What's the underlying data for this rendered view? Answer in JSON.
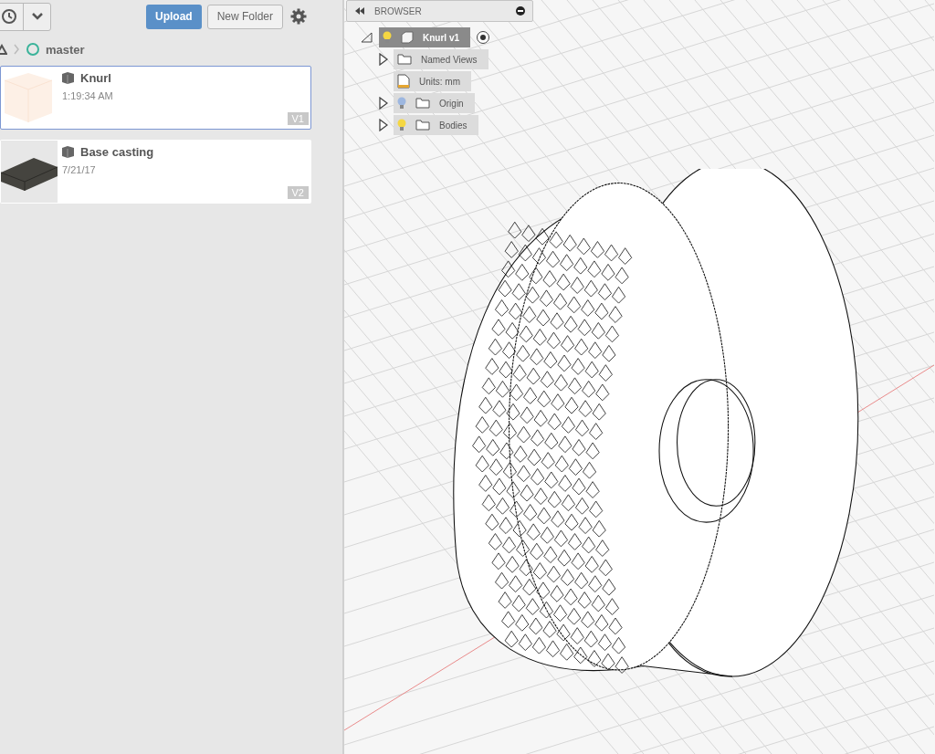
{
  "toolbar": {
    "upload": "Upload",
    "new_folder": "New Folder"
  },
  "breadcrumb": {
    "branch": "master"
  },
  "files": [
    {
      "name": "Knurl",
      "date": "1:19:34 AM",
      "version": "V1",
      "selected": true,
      "kind": "cube"
    },
    {
      "name": "Base casting",
      "date": "7/21/17",
      "version": "V2",
      "selected": false,
      "kind": "slab"
    }
  ],
  "browser": {
    "title": "BROWSER",
    "root": {
      "label": "Knurl v1",
      "selected": true,
      "visible": true,
      "children": [
        {
          "kind": "folder",
          "label": "Named Views"
        },
        {
          "kind": "units",
          "label": "Units: mm"
        },
        {
          "kind": "light-folder",
          "label": "Origin",
          "visible": false
        },
        {
          "kind": "light-folder",
          "label": "Bodies",
          "visible": true
        }
      ]
    }
  }
}
